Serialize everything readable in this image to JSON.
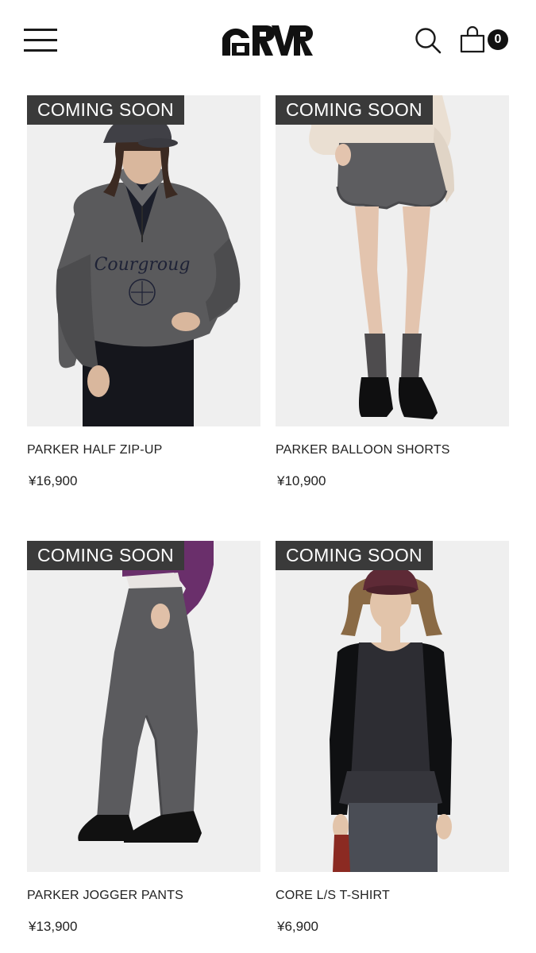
{
  "header": {
    "menu_icon": "hamburger-menu-icon",
    "logo_text": "GRVR",
    "search_icon": "search-icon",
    "cart_icon": "shopping-bag-icon",
    "cart_count": "0"
  },
  "products": [
    {
      "badge": "COMING SOON",
      "name": "PARKER HALF ZIP-UP",
      "price": "¥16,900"
    },
    {
      "badge": "COMING SOON",
      "name": "PARKER BALLOON SHORTS",
      "price": "¥10,900"
    },
    {
      "badge": "COMING SOON",
      "name": "PARKER JOGGER PANTS",
      "price": "¥13,900"
    },
    {
      "badge": "COMING SOON",
      "name": "CORE L/S T-SHIRT",
      "price": "¥6,900"
    }
  ]
}
